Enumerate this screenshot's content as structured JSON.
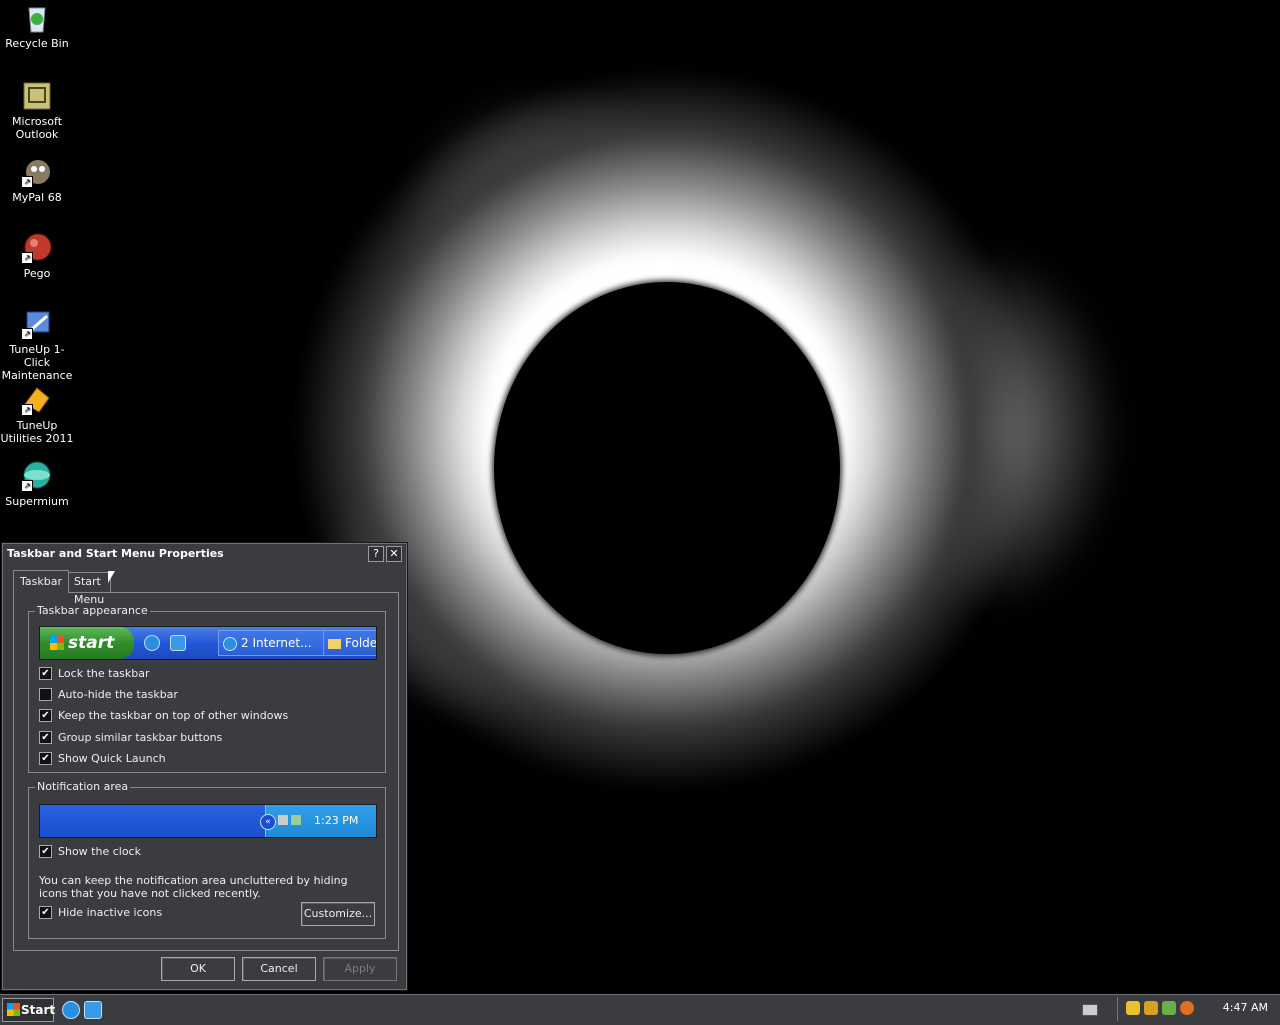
{
  "desktop": {
    "icons": [
      {
        "label": "Recycle Bin"
      },
      {
        "label": "Microsoft Outlook"
      },
      {
        "label": "MyPal 68"
      },
      {
        "label": "Pego"
      },
      {
        "label": "TuneUp 1-Click Maintenance"
      },
      {
        "label": "TuneUp Utilities 2011"
      },
      {
        "label": "Supermium"
      }
    ]
  },
  "dialog": {
    "title": "Taskbar and Start Menu Properties",
    "help_label": "?",
    "close_label": "✕",
    "tabs": [
      {
        "label": "Taskbar"
      },
      {
        "label": "Start Menu"
      }
    ],
    "taskbar_appearance": {
      "group_label": "Taskbar appearance",
      "preview": {
        "start_label": "start",
        "task_button_1": "2 Internet...",
        "task_button_2": "Folde"
      },
      "options": [
        {
          "label": "Lock the taskbar",
          "checked": "✔"
        },
        {
          "label": "Auto-hide the taskbar",
          "checked": ""
        },
        {
          "label": "Keep the taskbar on top of other windows",
          "checked": "✔"
        },
        {
          "label": "Group similar taskbar buttons",
          "checked": "✔"
        },
        {
          "label": "Show Quick Launch",
          "checked": "✔"
        }
      ]
    },
    "notification_area": {
      "group_label": "Notification area",
      "preview_time": "1:23 PM",
      "show_clock": {
        "label": "Show the clock",
        "checked": "✔"
      },
      "description": "You can keep the notification area uncluttered by hiding icons that you have not clicked recently.",
      "hide_inactive": {
        "label": "Hide inactive icons",
        "checked": "✔"
      },
      "customize_label": "Customize..."
    },
    "buttons": {
      "ok": "OK",
      "cancel": "Cancel",
      "apply": "Apply"
    }
  },
  "taskbar": {
    "start_label": "Start",
    "clock": "4:47 AM"
  },
  "colors": {
    "dialog_bg": "#3a3c40",
    "xp_blue": "#2458d8",
    "start_green": "#2f8e2a"
  }
}
